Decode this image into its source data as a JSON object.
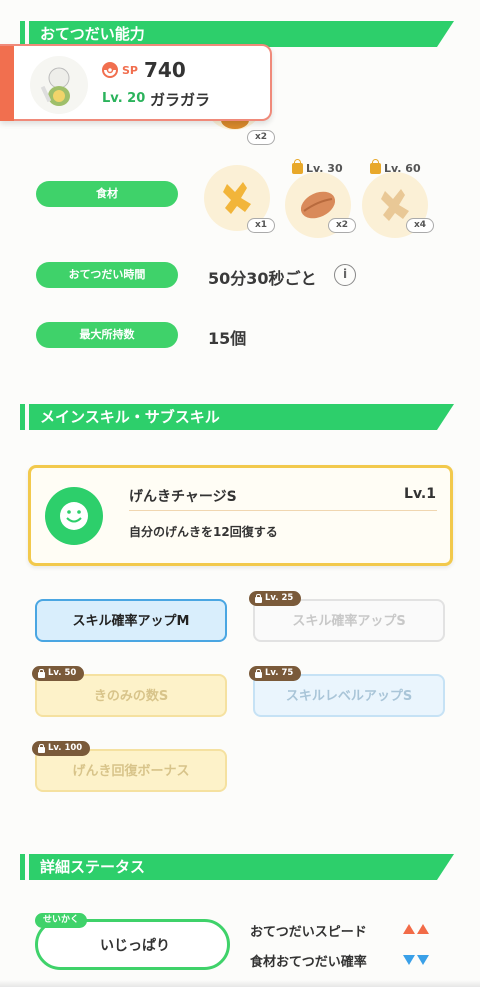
{
  "section_help": {
    "title": "おてつだい能力"
  },
  "pokemon": {
    "sp_label": "SP",
    "sp_value": "740",
    "level": "Lv. 20",
    "name": "ガラガラ"
  },
  "berry": {
    "count": "x2"
  },
  "ingredients": {
    "label": "食材",
    "items": [
      {
        "count": "x1",
        "unlock": ""
      },
      {
        "count": "x2",
        "unlock": "Lv. 30"
      },
      {
        "count": "x4",
        "unlock": "Lv. 60"
      }
    ]
  },
  "help_time": {
    "label": "おてつだい時間",
    "value": "50分30秒ごと"
  },
  "carry": {
    "label": "最大所持数",
    "value": "15個"
  },
  "section_skill": {
    "title": "メインスキル・サブスキル"
  },
  "main_skill": {
    "name": "げんきチャージS",
    "level": "Lv.1",
    "desc": "自分のげんきを12回復する"
  },
  "sub_skills": [
    {
      "label": "スキル確率アップM",
      "unlock": ""
    },
    {
      "label": "スキル確率アップS",
      "unlock": "Lv. 25"
    },
    {
      "label": "きのみの数S",
      "unlock": "Lv. 50"
    },
    {
      "label": "スキルレベルアップS",
      "unlock": "Lv. 75"
    },
    {
      "label": "げんき回復ボーナス",
      "unlock": "Lv. 100"
    }
  ],
  "section_detail": {
    "title": "詳細ステータス"
  },
  "nature": {
    "tag": "せいかく",
    "value": "いじっぱり",
    "up_label": "おてつだいスピード",
    "down_label": "食材おてつだい確率",
    "up_color": "#f26b47",
    "down_color": "#3aa0e8"
  }
}
